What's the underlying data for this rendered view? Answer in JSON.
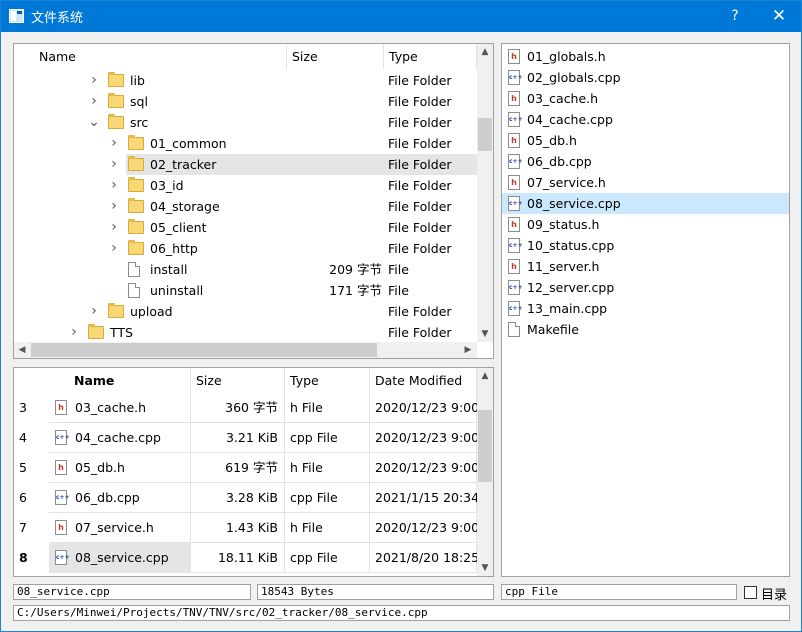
{
  "window": {
    "title": "文件系统",
    "help_label": "?",
    "close_label": "✕"
  },
  "tree": {
    "headers": {
      "name": "Name",
      "size": "Size",
      "type": "Type"
    },
    "rows": [
      {
        "name": "lib",
        "size": "",
        "type": "File Folder",
        "kind": "folder",
        "depth": 3,
        "expander": "›"
      },
      {
        "name": "sql",
        "size": "",
        "type": "File Folder",
        "kind": "folder",
        "depth": 3,
        "expander": "›"
      },
      {
        "name": "src",
        "size": "",
        "type": "File Folder",
        "kind": "folder",
        "depth": 3,
        "expander": "⌄"
      },
      {
        "name": "01_common",
        "size": "",
        "type": "File Folder",
        "kind": "folder",
        "depth": 4,
        "expander": "›"
      },
      {
        "name": "02_tracker",
        "size": "",
        "type": "File Folder",
        "kind": "folder",
        "depth": 4,
        "expander": "›",
        "selected": true
      },
      {
        "name": "03_id",
        "size": "",
        "type": "File Folder",
        "kind": "folder",
        "depth": 4,
        "expander": "›"
      },
      {
        "name": "04_storage",
        "size": "",
        "type": "File Folder",
        "kind": "folder",
        "depth": 4,
        "expander": "›"
      },
      {
        "name": "05_client",
        "size": "",
        "type": "File Folder",
        "kind": "folder",
        "depth": 4,
        "expander": "›"
      },
      {
        "name": "06_http",
        "size": "",
        "type": "File Folder",
        "kind": "folder",
        "depth": 4,
        "expander": "›"
      },
      {
        "name": "install",
        "size": "209 字节",
        "type": "File",
        "kind": "file",
        "depth": 4,
        "expander": ""
      },
      {
        "name": "uninstall",
        "size": "171 字节",
        "type": "File",
        "kind": "file",
        "depth": 4,
        "expander": ""
      },
      {
        "name": "upload",
        "size": "",
        "type": "File Folder",
        "kind": "folder",
        "depth": 3,
        "expander": "›"
      },
      {
        "name": "TTS",
        "size": "",
        "type": "File Folder",
        "kind": "folder",
        "depth": 2,
        "expander": "›"
      }
    ]
  },
  "table": {
    "headers": {
      "name": "Name",
      "size": "Size",
      "type": "Type",
      "modified": "Date Modified"
    },
    "rows": [
      {
        "num": "3",
        "name": "03_cache.h",
        "size": "360 字节",
        "type": "h File",
        "modified": "2020/12/23 9:00",
        "kind": "h"
      },
      {
        "num": "4",
        "name": "04_cache.cpp",
        "size": "3.21 KiB",
        "type": "cpp File",
        "modified": "2020/12/23 9:00",
        "kind": "cpp"
      },
      {
        "num": "5",
        "name": "05_db.h",
        "size": "619 字节",
        "type": "h File",
        "modified": "2020/12/23 9:00",
        "kind": "h"
      },
      {
        "num": "6",
        "name": "06_db.cpp",
        "size": "3.28 KiB",
        "type": "cpp File",
        "modified": "2021/1/15 20:34",
        "kind": "cpp"
      },
      {
        "num": "7",
        "name": "07_service.h",
        "size": "1.43 KiB",
        "type": "h File",
        "modified": "2020/12/23 9:00",
        "kind": "h"
      },
      {
        "num": "8",
        "name": "08_service.cpp",
        "size": "18.11 KiB",
        "type": "cpp File",
        "modified": "2021/8/20 18:25",
        "kind": "cpp",
        "selected": true
      }
    ]
  },
  "list": {
    "items": [
      {
        "name": "01_globals.h",
        "kind": "h"
      },
      {
        "name": "02_globals.cpp",
        "kind": "cpp"
      },
      {
        "name": "03_cache.h",
        "kind": "h"
      },
      {
        "name": "04_cache.cpp",
        "kind": "cpp"
      },
      {
        "name": "05_db.h",
        "kind": "h"
      },
      {
        "name": "06_db.cpp",
        "kind": "cpp"
      },
      {
        "name": "07_service.h",
        "kind": "h"
      },
      {
        "name": "08_service.cpp",
        "kind": "cpp",
        "selected": true
      },
      {
        "name": "09_status.h",
        "kind": "h"
      },
      {
        "name": "10_status.cpp",
        "kind": "cpp"
      },
      {
        "name": "11_server.h",
        "kind": "h"
      },
      {
        "name": "12_server.cpp",
        "kind": "cpp"
      },
      {
        "name": "13_main.cpp",
        "kind": "cpp"
      },
      {
        "name": "Makefile",
        "kind": "file"
      }
    ]
  },
  "status": {
    "filename": "08_service.cpp",
    "size": "18543 Bytes",
    "filetype": "cpp File",
    "dir_label": "目录",
    "path": "C:/Users/Minwei/Projects/TNV/TNV/src/02_tracker/08_service.cpp"
  },
  "icons": {
    "h": "h-file-icon",
    "cpp": "cpp-file-icon",
    "file": "file-icon",
    "folder": "folder-icon"
  },
  "colors": {
    "titlebar": "#0078d7",
    "selection": "#cce8ff",
    "tree_selection": "#e5e5e5"
  }
}
